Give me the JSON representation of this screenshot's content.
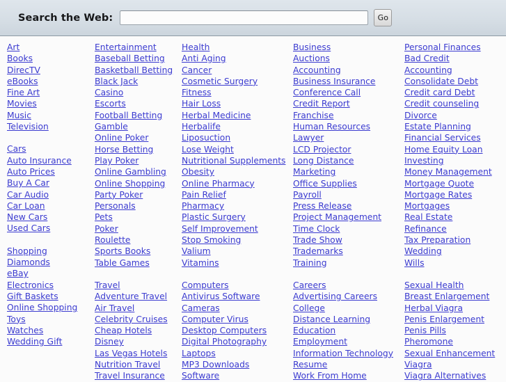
{
  "search": {
    "label": "Search the Web:",
    "value": "",
    "placeholder": "",
    "go_label": "Go"
  },
  "colors": {
    "link": "#3b3bd0",
    "header_bg": "#d6dee5",
    "page_bg": "#fbfbfb"
  },
  "directory": {
    "columns": [
      {
        "name": "column-1",
        "groups": [
          {
            "heading": "Art",
            "items": [
              "Art",
              "Books",
              "DirecTV",
              "eBooks",
              "Fine Art",
              "Movies",
              "Music",
              "Television"
            ]
          },
          {
            "heading": "Cars",
            "items": [
              "Cars",
              "Auto Insurance",
              "Auto Prices",
              "Buy A Car",
              "Car Audio",
              "Car Loan",
              "New Cars",
              "Used Cars"
            ]
          },
          {
            "heading": "Shopping",
            "items": [
              "Shopping",
              "Diamonds",
              "eBay",
              "Electronics",
              "Gift Baskets",
              "Online Shopping",
              "Toys",
              "Watches",
              "Wedding Gift"
            ]
          }
        ]
      },
      {
        "name": "column-2",
        "groups": [
          {
            "heading": "Entertainment",
            "items": [
              "Entertainment",
              "Baseball Betting",
              "Basketball Betting",
              "Black Jack",
              "Casino",
              "Escorts",
              "Football Betting",
              "Gamble",
              "Online Poker",
              "Horse Betting",
              "Play Poker",
              "Online Gambling",
              "Online Shopping",
              "Party Poker",
              "Personals",
              "Pets",
              "Poker",
              "Roulette",
              "Sports Books",
              "Table Games"
            ]
          },
          {
            "heading": "Travel",
            "items": [
              "Travel",
              "Adventure Travel",
              "Air Travel",
              "Celebrity Cruises",
              "Cheap Hotels",
              "Disney",
              "Las Vegas Hotels",
              "Nutrition Travel",
              "Travel Insurance"
            ]
          }
        ]
      },
      {
        "name": "column-3",
        "groups": [
          {
            "heading": "Health",
            "items": [
              "Health",
              "Anti Aging",
              "Cancer",
              "Cosmetic Surgery",
              "Fitness",
              "Hair Loss",
              "Herbal Medicine",
              "Herbalife",
              "Liposuction",
              "Lose Weight",
              "Nutritional Supplements",
              "Obesity",
              "Online Pharmacy",
              "Pain Relief",
              "Pharmacy",
              "Plastic Surgery",
              "Self Improvement",
              "Stop Smoking",
              "Valium",
              "Vitamins"
            ]
          },
          {
            "heading": "Computers",
            "items": [
              "Computers",
              "Antivirus Software",
              "Cameras",
              "Computer Virus",
              "Desktop Computers",
              "Digital Photography",
              "Laptops",
              "MP3 Downloads",
              "Software"
            ]
          }
        ]
      },
      {
        "name": "column-4",
        "groups": [
          {
            "heading": "Business",
            "items": [
              "Business",
              "Auctions",
              "Accounting",
              "Business Insurance",
              "Conference Call",
              "Credit Report",
              "Franchise",
              "Human Resources",
              "Lawyer",
              "LCD Projector",
              "Long Distance",
              "Marketing",
              "Office Supplies",
              "Payroll",
              "Press Release",
              "Project Management",
              "Time Clock",
              "Trade Show",
              "Trademarks",
              "Training"
            ]
          },
          {
            "heading": "Careers",
            "items": [
              "Careers",
              "Advertising Careers",
              "College",
              "Distance Learning",
              "Education",
              "Employment",
              "Information Technology",
              "Resume",
              "Work From Home"
            ]
          }
        ]
      },
      {
        "name": "column-5",
        "groups": [
          {
            "heading": "Personal Finances",
            "items": [
              "Personal Finances",
              "Bad Credit",
              "Accounting",
              "Consolidate Debt",
              "Credit card Debt",
              "Credit counseling",
              "Divorce",
              "Estate Planning",
              "Financial Services",
              "Home Equity Loan",
              "Investing",
              "Money Management",
              "Mortgage Quote",
              "Mortgage Rates",
              "Mortgages",
              "Real Estate",
              "Refinance",
              "Tax Preparation",
              "Wedding",
              "Wills"
            ]
          },
          {
            "heading": "Sexual Health",
            "items": [
              "Sexual Health",
              "Breast Enlargement",
              "Herbal Viagra",
              "Penis Enlargement",
              "Penis Pills",
              "Pheromone",
              "Sexual Enhancement",
              "Viagra",
              "Viagra Alternatives"
            ]
          }
        ]
      }
    ]
  }
}
